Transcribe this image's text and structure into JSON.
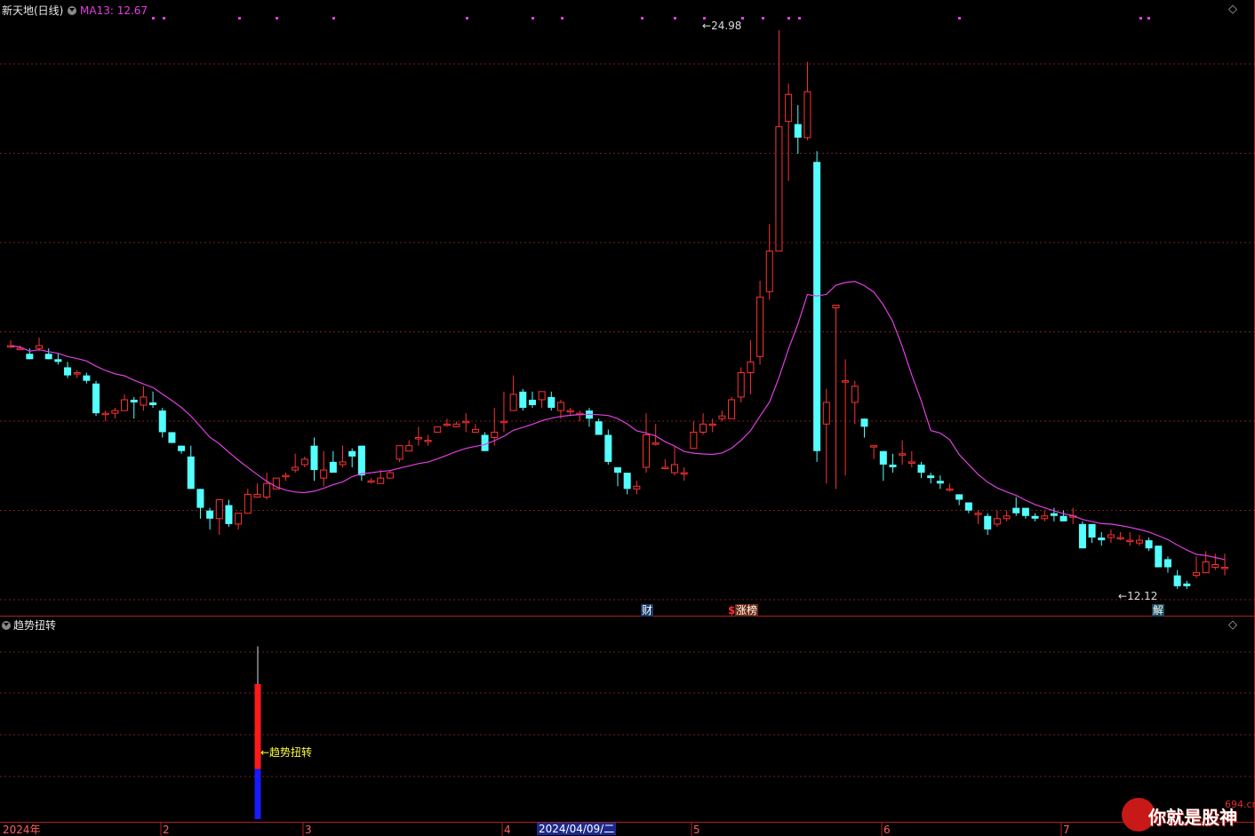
{
  "header": {
    "stock_title": "新天地(日线)",
    "ma_label": "MA13: 12.67",
    "ma_color": "#e040e0"
  },
  "main_chart": {
    "high_label": "24.98",
    "low_label": "12.12",
    "event_markers": [
      {
        "text": "财",
        "style": "cai"
      },
      {
        "text": "$",
        "style": "dollar"
      },
      {
        "text": "涨榜",
        "style": "zhang"
      },
      {
        "text": "解",
        "style": "jie"
      }
    ]
  },
  "indicator": {
    "title": "趋势扭转",
    "annotation": "←趋势扭转"
  },
  "time_axis": {
    "labels": [
      "2024年",
      "2",
      "3",
      "4",
      "2024/04/09/二",
      "5",
      "6",
      "7"
    ]
  },
  "watermark": {
    "site": "694.cn",
    "text": "你就是股神"
  },
  "colors": {
    "up": "#ff3232",
    "down": "#54ffff",
    "grid": "#7a1f1f",
    "axis": "#b02020",
    "ma13": "#e040e0"
  },
  "chart_data": {
    "type": "candlestick",
    "series_ma": "MA13",
    "ohlc": [
      [
        13.3,
        13.3,
        13.5,
        13.2
      ],
      [
        13.2,
        13.2,
        13.3,
        13.2
      ],
      [
        13.0,
        12.8,
        13.2,
        12.8
      ],
      [
        13.2,
        13.3,
        13.6,
        13.1
      ],
      [
        13.0,
        12.8,
        13.2,
        12.8
      ],
      [
        12.8,
        12.7,
        13.0,
        12.6
      ],
      [
        12.5,
        12.2,
        12.7,
        12.1
      ],
      [
        12.3,
        12.3,
        12.4,
        12.1
      ],
      [
        12.2,
        12.0,
        12.3,
        11.9
      ],
      [
        11.9,
        10.8,
        12.0,
        10.7
      ],
      [
        10.8,
        10.8,
        10.9,
        10.5
      ],
      [
        10.8,
        10.9,
        11.0,
        10.6
      ],
      [
        10.9,
        11.3,
        11.5,
        10.9
      ],
      [
        11.3,
        11.2,
        11.4,
        10.6
      ],
      [
        11.1,
        11.4,
        11.8,
        10.9
      ],
      [
        11.2,
        11.1,
        11.6,
        11.0
      ],
      [
        10.9,
        10.1,
        11.0,
        9.9
      ],
      [
        10.1,
        9.7,
        10.1,
        9.7
      ],
      [
        9.6,
        9.4,
        9.6,
        9.3
      ],
      [
        9.2,
        8.0,
        9.6,
        8.0
      ],
      [
        8.0,
        7.3,
        8.0,
        6.9
      ],
      [
        7.2,
        6.9,
        7.3,
        6.5
      ],
      [
        6.9,
        7.6,
        7.6,
        6.3
      ],
      [
        7.4,
        6.7,
        7.6,
        6.6
      ],
      [
        6.7,
        7.1,
        7.1,
        6.5
      ],
      [
        7.1,
        7.8,
        8.0,
        7.1
      ],
      [
        7.7,
        7.8,
        8.2,
        7.7
      ],
      [
        7.7,
        8.2,
        8.6,
        7.6
      ],
      [
        8.0,
        8.4,
        8.4,
        8.0
      ],
      [
        8.5,
        8.5,
        8.6,
        8.3
      ],
      [
        8.7,
        8.8,
        9.3,
        8.6
      ],
      [
        8.9,
        9.1,
        9.2,
        8.8
      ],
      [
        9.6,
        8.7,
        9.9,
        8.3
      ],
      [
        8.4,
        8.7,
        9.4,
        8.1
      ],
      [
        9.0,
        8.6,
        9.4,
        8.6
      ],
      [
        8.9,
        9.0,
        9.6,
        8.8
      ],
      [
        9.4,
        9.2,
        9.5,
        8.8
      ],
      [
        9.6,
        8.5,
        9.6,
        8.3
      ],
      [
        8.3,
        8.3,
        8.4,
        8.2
      ],
      [
        8.2,
        8.4,
        8.7,
        8.2
      ],
      [
        8.4,
        8.6,
        8.7,
        8.6
      ],
      [
        9.1,
        9.6,
        9.6,
        9.0
      ],
      [
        9.4,
        9.6,
        9.8,
        9.4
      ],
      [
        9.9,
        9.9,
        10.3,
        9.6
      ],
      [
        9.8,
        9.8,
        10.0,
        9.6
      ],
      [
        10.1,
        10.3,
        10.2,
        10.1
      ],
      [
        10.4,
        10.4,
        10.6,
        10.3
      ],
      [
        10.3,
        10.4,
        10.5,
        10.4
      ],
      [
        10.5,
        10.5,
        10.8,
        10.1
      ],
      [
        10.1,
        10.2,
        10.4,
        10.1
      ],
      [
        10.0,
        9.4,
        10.1,
        9.4
      ],
      [
        9.9,
        10.1,
        11.0,
        9.6
      ],
      [
        10.5,
        10.5,
        11.6,
        10.1
      ],
      [
        10.9,
        11.5,
        12.2,
        11.0
      ],
      [
        11.6,
        11.0,
        11.7,
        10.9
      ],
      [
        11.3,
        11.1,
        11.6,
        11.0
      ],
      [
        11.3,
        11.6,
        11.6,
        11.0
      ],
      [
        11.4,
        11.0,
        11.6,
        10.9
      ],
      [
        10.9,
        11.2,
        11.3,
        10.6
      ],
      [
        10.9,
        10.9,
        11.0,
        10.7
      ],
      [
        10.8,
        10.8,
        10.9,
        10.5
      ],
      [
        10.9,
        10.6,
        11.0,
        10.3
      ],
      [
        10.5,
        10.0,
        10.6,
        10.0
      ],
      [
        10.0,
        9.0,
        10.2,
        8.9
      ],
      [
        8.8,
        8.6,
        8.8,
        8.1
      ],
      [
        8.6,
        8.0,
        8.6,
        7.8
      ],
      [
        8.0,
        8.1,
        8.3,
        7.8
      ],
      [
        8.8,
        10.0,
        10.8,
        8.6
      ],
      [
        9.7,
        9.7,
        10.4,
        9.6
      ],
      [
        8.8,
        8.8,
        9.1,
        8.8
      ],
      [
        8.6,
        8.9,
        9.6,
        8.5
      ],
      [
        8.6,
        8.6,
        8.8,
        8.3
      ],
      [
        9.5,
        10.1,
        10.5,
        9.5
      ],
      [
        10.1,
        10.4,
        10.8,
        10.0
      ],
      [
        10.4,
        10.4,
        10.6,
        10.1
      ],
      [
        10.6,
        10.7,
        10.9,
        10.5
      ],
      [
        10.6,
        11.3,
        11.4,
        10.7
      ],
      [
        11.4,
        12.3,
        12.5,
        11.2
      ],
      [
        12.3,
        12.7,
        13.5,
        11.5
      ],
      [
        12.9,
        15.1,
        15.7,
        12.6
      ],
      [
        15.3,
        16.8,
        17.8,
        15.0
      ],
      [
        16.8,
        21.4,
        24.98,
        16.8
      ],
      [
        21.6,
        22.6,
        23.0,
        19.4
      ],
      [
        21.5,
        21.0,
        22.2,
        20.4
      ],
      [
        21.0,
        22.7,
        23.8,
        20.9
      ],
      [
        20.1,
        9.4,
        20.5,
        9.0
      ],
      [
        10.4,
        11.2,
        11.7,
        8.2
      ],
      [
        14.7,
        14.8,
        14.6,
        8.0
      ],
      [
        12.0,
        12.0,
        12.8,
        8.5
      ],
      [
        11.2,
        11.8,
        12.0,
        10.4
      ],
      [
        10.6,
        10.3,
        10.6,
        9.9
      ],
      [
        9.6,
        9.6,
        9.6,
        9.1
      ],
      [
        9.4,
        8.9,
        9.3,
        8.3
      ],
      [
        8.9,
        8.8,
        9.3,
        8.6
      ],
      [
        9.3,
        9.3,
        9.8,
        8.9
      ],
      [
        9.0,
        9.0,
        9.4,
        8.8
      ],
      [
        8.9,
        8.6,
        9.0,
        8.4
      ],
      [
        8.5,
        8.4,
        8.6,
        8.2
      ],
      [
        8.3,
        8.2,
        8.5,
        8.0
      ],
      [
        8.0,
        8.0,
        8.2,
        7.9
      ],
      [
        7.8,
        7.6,
        7.8,
        7.4
      ],
      [
        7.5,
        7.2,
        7.5,
        7.1
      ],
      [
        7.1,
        7.1,
        7.2,
        6.7
      ],
      [
        7.0,
        6.5,
        7.1,
        6.3
      ],
      [
        6.7,
        6.9,
        7.2,
        6.6
      ],
      [
        6.9,
        7.0,
        7.2,
        6.8
      ],
      [
        7.3,
        7.1,
        7.7,
        7.0
      ],
      [
        7.3,
        7.0,
        7.3,
        6.9
      ],
      [
        7.0,
        6.9,
        7.1,
        6.8
      ],
      [
        6.9,
        7.0,
        7.2,
        6.8
      ],
      [
        7.1,
        7.0,
        7.3,
        6.8
      ],
      [
        7.0,
        6.8,
        7.2,
        6.9
      ],
      [
        7.0,
        7.0,
        7.3,
        6.7
      ],
      [
        6.7,
        5.8,
        6.8,
        5.8
      ],
      [
        6.7,
        6.2,
        6.6,
        6.0
      ],
      [
        6.2,
        6.1,
        6.4,
        5.9
      ],
      [
        6.2,
        6.3,
        6.5,
        6.0
      ],
      [
        6.2,
        6.2,
        6.4,
        6.1
      ],
      [
        6.1,
        6.1,
        6.4,
        5.9
      ],
      [
        6.0,
        6.1,
        6.3,
        5.9
      ],
      [
        6.1,
        5.8,
        6.2,
        5.7
      ],
      [
        5.9,
        5.1,
        5.9,
        5.2
      ],
      [
        5.4,
        5.1,
        5.5,
        4.9
      ],
      [
        4.8,
        4.4,
        5.0,
        4.3
      ],
      [
        4.5,
        4.4,
        4.6,
        4.3
      ],
      [
        4.8,
        4.9,
        5.5,
        4.7
      ],
      [
        4.9,
        5.3,
        5.7,
        4.9
      ],
      [
        5.1,
        5.2,
        5.6,
        5.0
      ],
      [
        5.1,
        5.1,
        5.6,
        4.8
      ]
    ],
    "indicator_bar": {
      "top_red": 1.0,
      "split": 0.37,
      "wick_top": 1.28
    }
  }
}
